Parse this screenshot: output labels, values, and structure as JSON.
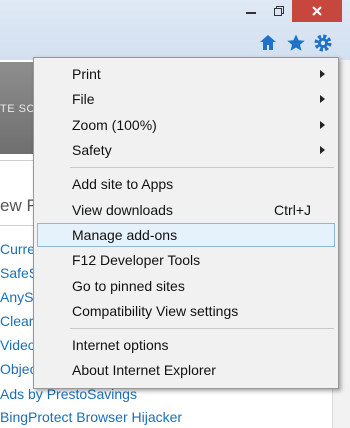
{
  "toolbar": {
    "minimize_icon": "minimize-icon",
    "restore_icon": "restore-icon",
    "close_icon": "close-icon",
    "home_icon": "home-icon",
    "favorites_icon": "star-icon",
    "tools_icon": "gear-icon",
    "accent": "#1e73c8"
  },
  "page": {
    "banner_text": "TE SCA",
    "heading_fragment": "ew F",
    "side_links": [
      "Curre",
      "SafeS",
      "AnyS",
      "Clear",
      "Video",
      "Objec"
    ],
    "bottom_links": [
      "Ads by PrestoSavings",
      "BingProtect Browser Hijacker"
    ]
  },
  "menu": {
    "items": [
      {
        "label": "Print",
        "submenu": true
      },
      {
        "label": "File",
        "submenu": true
      },
      {
        "label": "Zoom (100%)",
        "submenu": true
      },
      {
        "label": "Safety",
        "submenu": true
      },
      {
        "label": "Add site to Apps"
      },
      {
        "label": "View downloads",
        "shortcut": "Ctrl+J"
      },
      {
        "label": "Manage add-ons",
        "highlighted": true
      },
      {
        "label": "F12 Developer Tools"
      },
      {
        "label": "Go to pinned sites"
      },
      {
        "label": "Compatibility View settings"
      },
      {
        "label": "Internet options"
      },
      {
        "label": "About Internet Explorer"
      }
    ]
  }
}
